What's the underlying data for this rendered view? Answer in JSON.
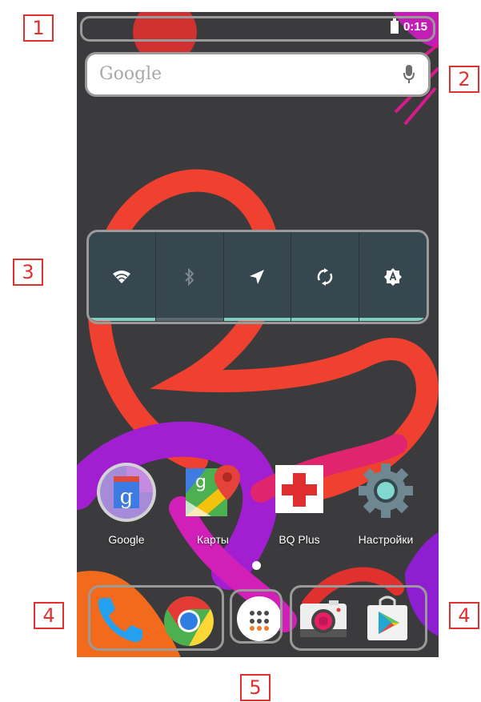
{
  "callouts": [
    "1",
    "2",
    "3",
    "4",
    "4",
    "5"
  ],
  "status_bar": {
    "time": "0:15",
    "battery_icon": "battery-icon"
  },
  "search_widget": {
    "label": "Google",
    "mic_icon": "mic-icon"
  },
  "quick_settings": {
    "tiles": [
      {
        "icon": "wifi-icon",
        "state": "on"
      },
      {
        "icon": "bluetooth-icon",
        "state": "off"
      },
      {
        "icon": "location-icon",
        "state": "on"
      },
      {
        "icon": "sync-icon",
        "state": "on"
      },
      {
        "icon": "auto-brightness-icon",
        "state": "on"
      }
    ]
  },
  "apps": [
    {
      "label": "Google",
      "icon": "google-search-icon"
    },
    {
      "label": "Карты",
      "icon": "maps-icon"
    },
    {
      "label": "BQ Plus",
      "icon": "bq-plus-icon"
    },
    {
      "label": "Настройки",
      "icon": "settings-gear-icon"
    }
  ],
  "dock": [
    {
      "icon": "phone-icon"
    },
    {
      "icon": "chrome-icon"
    },
    {
      "icon": "app-drawer-icon"
    },
    {
      "icon": "camera-icon"
    },
    {
      "icon": "play-store-icon"
    }
  ],
  "colors": {
    "callout": "#e0312f",
    "qs_background": "#37474f",
    "qs_active": "#7ecfc0"
  }
}
